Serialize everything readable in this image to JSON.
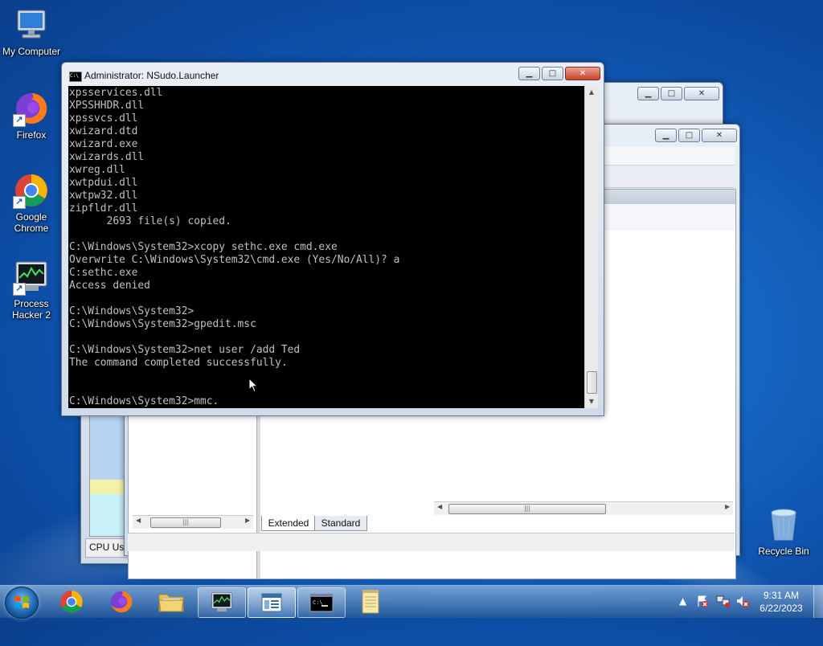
{
  "desktop": {
    "icons": [
      {
        "label": "My Computer",
        "icon": "computer-icon"
      },
      {
        "label": "Firefox",
        "icon": "firefox-icon"
      },
      {
        "label": "Google Chrome",
        "icon": "chrome-icon"
      },
      {
        "label": "Process Hacker 2",
        "icon": "process-hacker-icon"
      },
      {
        "label": "Recycle Bin",
        "icon": "recycle-bin-icon"
      }
    ]
  },
  "cmd_window": {
    "title": "Administrator: NSudo.Launcher",
    "console_lines": [
      "xpsservices.dll",
      "XPSSHHDR.dll",
      "xpssvcs.dll",
      "xwizard.dtd",
      "xwizard.exe",
      "xwizards.dll",
      "xwreg.dll",
      "xwtpdui.dll",
      "xwtpw32.dll",
      "zipfldr.dll",
      "      2693 file(s) copied.",
      "",
      "C:\\Windows\\System32>xcopy sethc.exe cmd.exe",
      "Overwrite C:\\Windows\\System32\\cmd.exe (Yes/No/All)? a",
      "C:sethc.exe",
      "Access denied",
      "",
      "C:\\Windows\\System32>",
      "C:\\Windows\\System32>gpedit.msc",
      "",
      "C:\\Windows\\System32>net user /add Ted",
      "The command completed successfully.",
      "",
      "",
      "C:\\Windows\\System32>mmc."
    ],
    "buttons": {
      "minimize": "minimize",
      "maximize": "maximize",
      "close": "close"
    }
  },
  "back_windows": {
    "task_manager": {
      "status_label": "CPU Usa"
    },
    "mmc": {
      "tabs": [
        "Extended",
        "Standard"
      ]
    }
  },
  "taskbar": {
    "start": "start-orb",
    "items": [
      {
        "name": "chrome",
        "icon": "chrome-icon",
        "state": "pinned"
      },
      {
        "name": "firefox",
        "icon": "firefox-icon",
        "state": "pinned"
      },
      {
        "name": "explorer",
        "icon": "folder-icon",
        "state": "pinned"
      },
      {
        "name": "process-hacker",
        "icon": "process-hacker-icon",
        "state": "open"
      },
      {
        "name": "mmc",
        "icon": "mmc-icon",
        "state": "active"
      },
      {
        "name": "cmd",
        "icon": "cmd-icon",
        "state": "open"
      },
      {
        "name": "notepad",
        "icon": "notepad-icon",
        "state": "pinned"
      }
    ],
    "tray": {
      "chevron": "▲"
    },
    "clock": {
      "time": "9:31 AM",
      "date": "6/22/2023"
    }
  }
}
